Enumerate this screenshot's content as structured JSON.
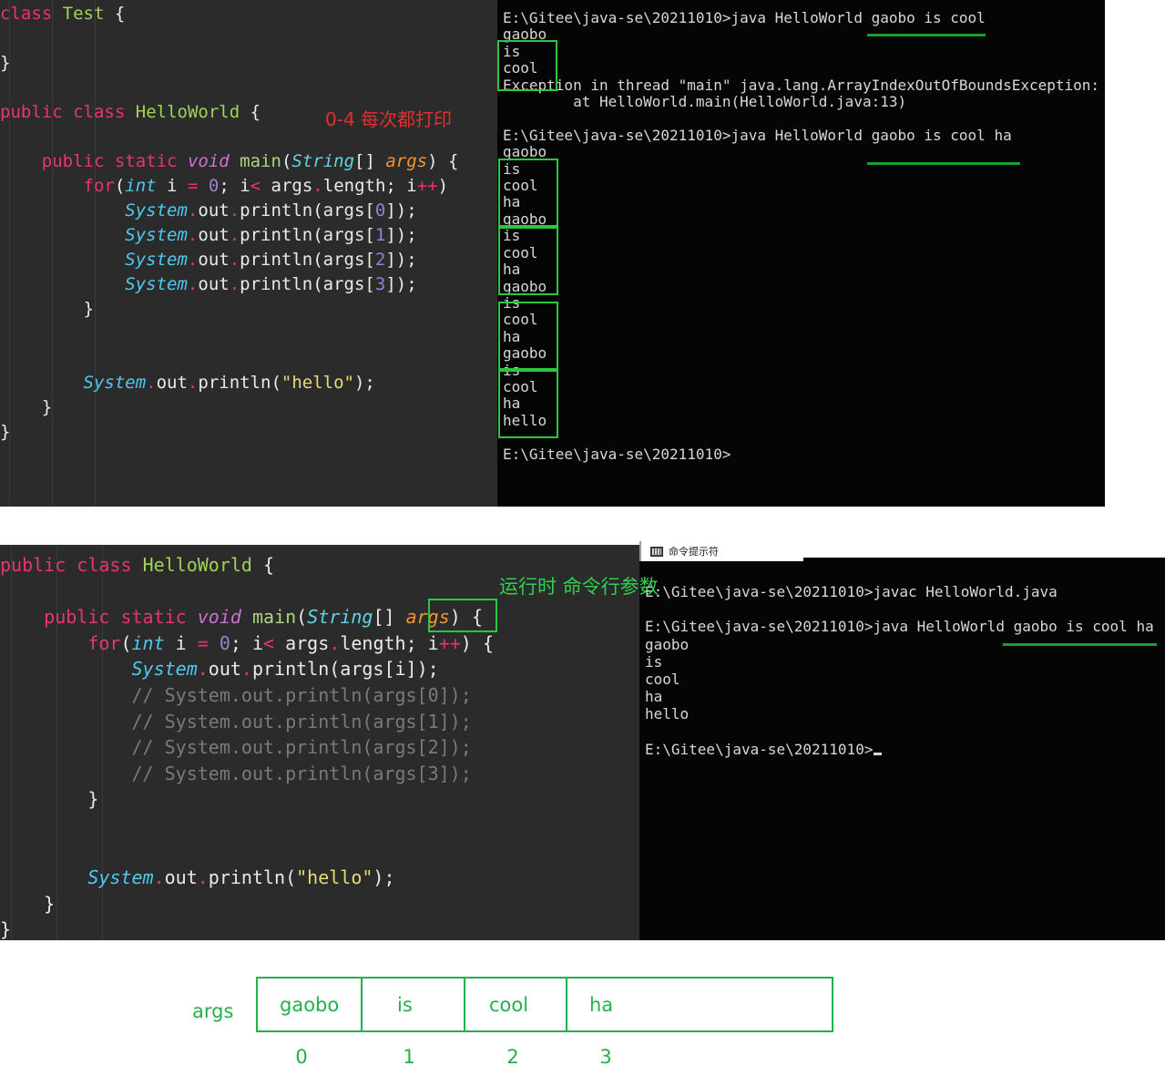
{
  "colors": {
    "editor_bg": "#2b2b2b",
    "terminal_bg": "#050505",
    "highlight_green": "#28c840",
    "annotation_red": "#e03131",
    "annotation_green": "#2fd14f",
    "diagram_green": "#22b14c"
  },
  "panel1": {
    "code": {
      "lines": [
        "class Test {",
        "",
        "}",
        "",
        "public class HelloWorld {",
        "",
        "    public static void main(String[] args) {",
        "        for(int i = 0; i< args.length; i++)",
        "            System.out.println(args[0]);",
        "            System.out.println(args[1]);",
        "            System.out.println(args[2]);",
        "            System.out.println(args[3]);",
        "        }",
        "",
        "",
        "        System.out.println(\"hello\");",
        "    }",
        "}"
      ]
    },
    "annotation": "0-4 每次都打印",
    "terminal": {
      "lines": [
        "E:\\Gitee\\java-se\\20211010>java HelloWorld gaobo is cool",
        "gaobo",
        "is",
        "cool",
        "Exception in thread \"main\" java.lang.ArrayIndexOutOfBoundsException:",
        "        at HelloWorld.main(HelloWorld.java:13)",
        "",
        "E:\\Gitee\\java-se\\20211010>java HelloWorld gaobo is cool ha",
        "gaobo",
        "is",
        "cool",
        "ha",
        "gaobo",
        "is",
        "cool",
        "ha",
        "gaobo",
        "is",
        "cool",
        "ha",
        "gaobo",
        "is",
        "cool",
        "ha",
        "hello",
        "",
        "E:\\Gitee\\java-se\\20211010>"
      ]
    }
  },
  "panel2": {
    "code": {
      "lines": [
        "public class HelloWorld {",
        "",
        "    public static void main(String[] args) {",
        "        for(int i = 0; i< args.length; i++) {",
        "            System.out.println(args[i]);",
        "            // System.out.println(args[0]);",
        "            // System.out.println(args[1]);",
        "            // System.out.println(args[2]);",
        "            // System.out.println(args[3]);",
        "        }",
        "",
        "",
        "        System.out.println(\"hello\");",
        "    }",
        "}"
      ]
    },
    "annotation": "运行时 命令行参数",
    "window_title": "命令提示符",
    "terminal": {
      "lines": [
        "E:\\Gitee\\java-se\\20211010>javac HelloWorld.java",
        "",
        "E:\\Gitee\\java-se\\20211010>java HelloWorld gaobo is cool ha",
        "gaobo",
        "is",
        "cool",
        "ha",
        "hello",
        "",
        "E:\\Gitee\\java-se\\20211010>"
      ]
    }
  },
  "array_diagram": {
    "label": "args",
    "cells": [
      "gaobo",
      "is",
      "cool",
      "ha"
    ],
    "indices": [
      "0",
      "1",
      "2",
      "3"
    ]
  }
}
